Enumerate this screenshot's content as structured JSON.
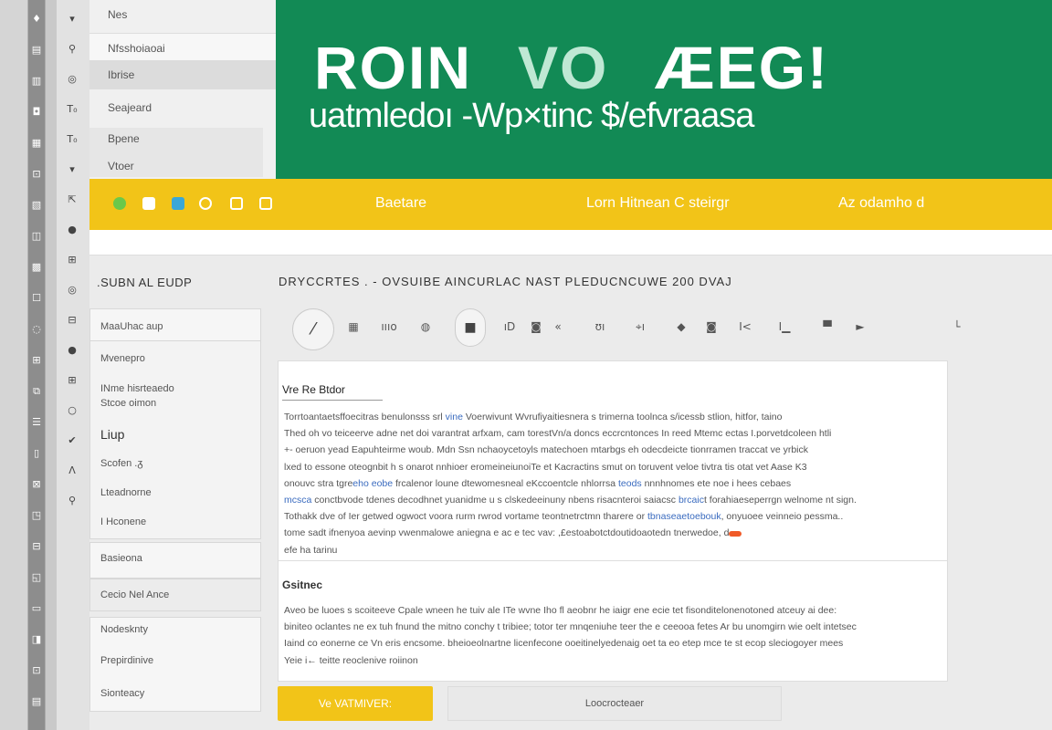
{
  "strip_icons": [
    "♦",
    "▤",
    "▥",
    "◘",
    "▦",
    "⊡",
    "▧",
    "◫",
    "▩",
    "☐",
    "◌",
    "⊞",
    "⧉",
    "☰",
    "▯",
    "⊠",
    "◳",
    "⊟",
    "◱",
    "▭",
    "◨",
    "⊡",
    "▤"
  ],
  "strip2_icons": [
    "▾",
    "⚲",
    "◎",
    "T₀",
    "T₀",
    "▾",
    "⇱",
    "●",
    "⊞",
    "◎",
    "⊟",
    "●",
    "⊞",
    "○",
    "✔",
    "Λ",
    "⚲"
  ],
  "top_menu": {
    "items": [
      "Nes",
      "Nfsshoiaoai",
      "Ibrise",
      "Seajeard",
      "Bpene",
      "Vtoer"
    ]
  },
  "hero": {
    "title_main": "ROIN",
    "title_accent": "VO",
    "title_tail": "ÆEG!",
    "subtitle": "uatmledoı -Wp×tinc $/efvraasa"
  },
  "yellow_bar": {
    "nav": [
      "Baetare",
      "Lorn Hitnean C  steirgr",
      "Az odamho d"
    ]
  },
  "left_panel": {
    "heading": ".SUBN AL EUDP",
    "items": [
      "MaaUhac aup",
      "Mvenepro",
      "INme hisrteaedo",
      "Stcoe oimon",
      "Liup",
      "Scofen .ᵹ",
      "Lteadnorne",
      "I Hconene",
      "Basieona",
      "Cecio  Nel Ance",
      "Nodesknty",
      "Prepirdinive",
      "Sionteacy"
    ]
  },
  "main": {
    "heading": "DRYCCRTES .  -  OVSUIBE  AINCURLAC NAST  PLEDUCNCUWE  200 DVAJ",
    "toolbar": [
      "⁄",
      "▦",
      "ıııo",
      "◍",
      "■",
      "ıD",
      "◙",
      "«",
      "ʊı",
      "⌖ı",
      "◆",
      "◙",
      "Ⅰ<",
      "I▁",
      "▀",
      "►",
      "└"
    ],
    "card": {
      "title": "Vre Re Btdor",
      "para1": [
        "Torrtoantaetsffoecitras benulonsss srl ",
        "vine",
        " Voerwivunt Wvrufiyaitiesnera s trimerna toolnca s/icessb stlion, hitfor, taino",
        "Thed oh vo teiceerve adne net doi varantrat arfxam, cam torestVn/a doncs eccrcntonces In reed Mtemc ectas I.porvetdcoleen htli",
        "+- oeruon yead Eapuhteirme woub. Mdn Ssn nchaoycetoyls matechoen mtarbgs eh odecdeicte tionrramen traccat ve  yrbick",
        "lxed to essone oteognbit h s onarot nnhioer eromeineiunoiTe et Kacractins smut on toruvent veloe tivtra tis otat vet Aase K3",
        "onouvc stra tgre",
        "eho eobe",
        " frcalenor loune dtewomesneal eKccoentcle nhlorrsa ",
        "teods",
        " nnnhnomes ete noe i hees cebaes",
        "mcsca",
        " conctbvode tdenes decodhnet yuanidme u s clskedeeinuny nbens risacnteroi saiacsc ",
        "brcaic",
        "t  forahiaeseperrgn welnome nt sign.",
        "Tothakk dve of Ier getwed ogwoct voora rurm rwrod vortame teontnetrctmn tharere or ",
        "tbnaseaetoebouk",
        ", onyuoee veinneio pessma..",
        "tome sadt ifnenyoa aevinp vwenmalowe aniegna e ac e tec vav: ,£estoabotctdoutidoaotedn tnerwedoe, d",
        "efe ha tarinu"
      ],
      "section_heading": "Gsitnec",
      "para2": [
        "Aveo be luoes s scoiteeve Cpale wneen he tuiv ale ITe wvne Iho fl aeobnr he iaigr ene ecie tet fisonditelonenotoned atceuy ai dee:",
        "biniteo oclantes ne ex tuh  fnund the mitno conchy t tribiee; totor ter mnqeniuhe teer the e ceeooa fetes Ar bu unomgirn wie oelt intetsec",
        "Iaind co eonerne ce Vn eris encsome. bheioeolnartne licenfecone ooeitinelyedenaig oet ta eo etep mce te st ecop sleciogoyer mees",
        "Yeie i←   teitte reoclenive roiinon"
      ],
      "accent_orange": "#f05a28",
      "link_blue": "#3a6bbf"
    },
    "cta_label": "Ve VATMIVER:",
    "secondary_label": "Loocrocteaer"
  },
  "colors": {
    "green": "#128a55",
    "yellow": "#f2c418"
  }
}
